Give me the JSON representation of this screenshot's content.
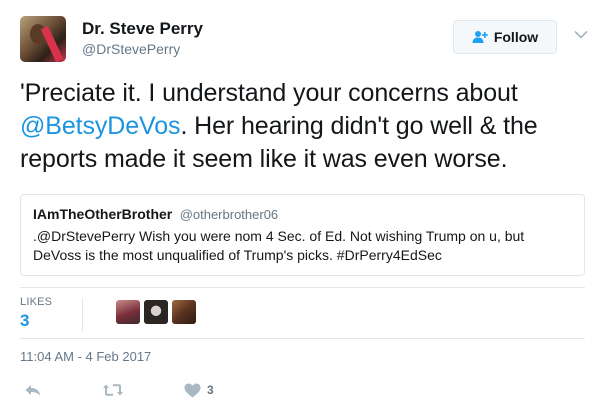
{
  "user": {
    "display_name": "Dr. Steve Perry",
    "handle": "@DrStevePerry"
  },
  "follow_button": {
    "label": "Follow"
  },
  "tweet": {
    "text_parts": [
      "'Preciate it. I understand your concerns about ",
      "@BetsyDeVos",
      ". Her hearing didn't go well & the reports made it seem like it was even worse."
    ]
  },
  "quoted_tweet": {
    "display_name": "IAmTheOtherBrother",
    "handle": "@otherbrother06",
    "text": ".@DrStevePerry Wish you were nom 4 Sec. of Ed. Not wishing Trump on u, but DeVoss is the most unqualified of Trump's picks. #DrPerry4EdSec"
  },
  "stats": {
    "likes_label": "LIKES",
    "likes_count": "3"
  },
  "timestamp": "11:04 AM - 4 Feb 2017",
  "actions": {
    "reply_icon": "reply-icon",
    "retweet_icon": "retweet-icon",
    "like_icon": "heart-icon",
    "like_count": "3"
  },
  "colors": {
    "link": "#1b95e0",
    "secondary_text": "#657786",
    "border": "#e1e8ed"
  }
}
